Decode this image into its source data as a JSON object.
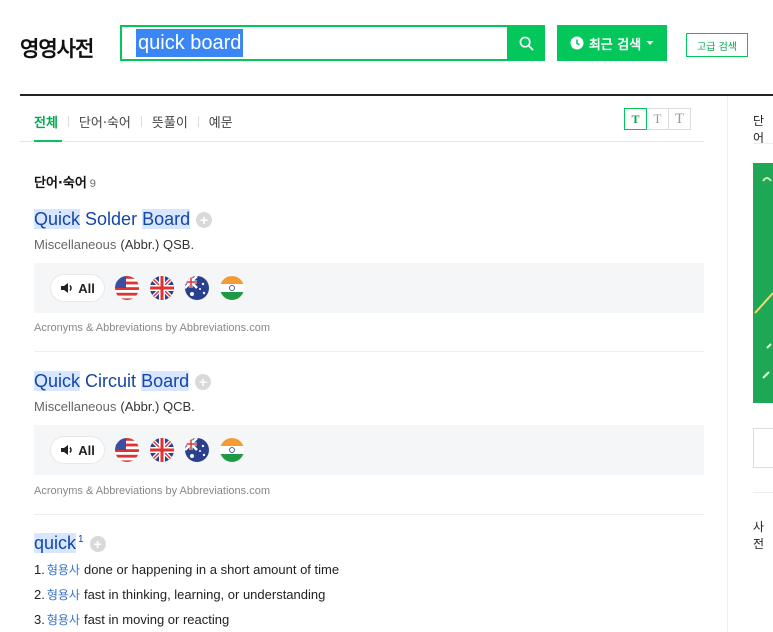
{
  "header": {
    "logo": "영영사전",
    "search_value": "quick board",
    "recent_label": "최근 검색",
    "advanced_label": "고급 검색"
  },
  "tabs": [
    "전체",
    "단어·숙어",
    "뜻풀이",
    "예문"
  ],
  "font_size_buttons": [
    "T",
    "T",
    "T"
  ],
  "section": {
    "title": "단어·숙어",
    "count": "9"
  },
  "entries": [
    {
      "title_words": [
        "Quick",
        "Solder",
        "Board"
      ],
      "category": "Miscellaneous",
      "abbr": "(Abbr.) QSB.",
      "all_label": "All",
      "source": "Acronyms & Abbreviations by Abbreviations.com"
    },
    {
      "title_words": [
        "Quick",
        "Circuit",
        "Board"
      ],
      "category": "Miscellaneous",
      "abbr": "(Abbr.) QCB.",
      "all_label": "All",
      "source": "Acronyms & Abbreviations by Abbreviations.com"
    }
  ],
  "word_entry": {
    "word": "quick",
    "superscript": "1",
    "definitions": [
      {
        "num": "1.",
        "pos": "형용사",
        "text": "done or happening in a short amount of time"
      },
      {
        "num": "2.",
        "pos": "형용사",
        "text": "fast in thinking, learning, or understanding"
      },
      {
        "num": "3.",
        "pos": "형용사",
        "text": "fast in moving or reacting"
      }
    ]
  },
  "right_column": {
    "label_top": "단어",
    "label_bottom": "사전"
  },
  "flags": [
    "us-flag-icon",
    "uk-flag-icon",
    "au-flag-icon",
    "in-flag-icon"
  ],
  "colors": {
    "brand_green": "#03c75a",
    "link_blue": "#1346a8",
    "highlight": "#d8e7ff"
  }
}
